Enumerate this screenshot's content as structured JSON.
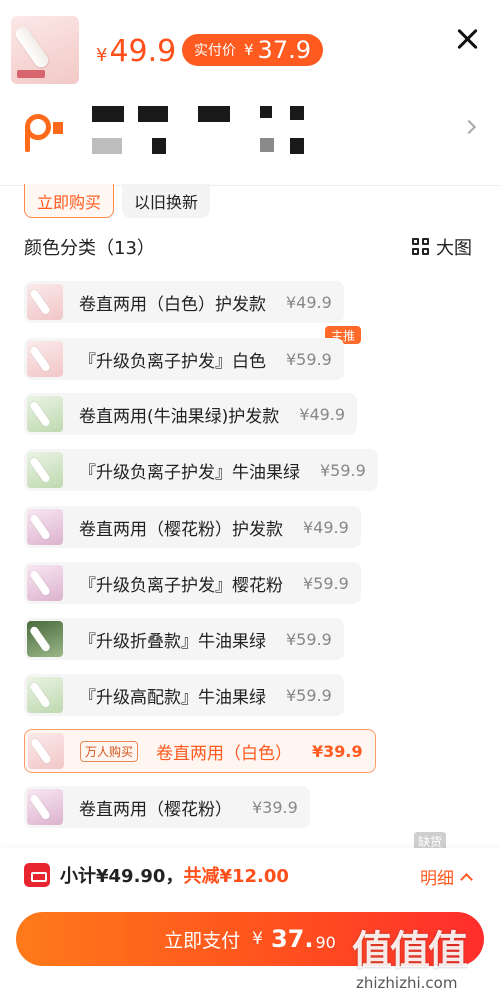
{
  "header": {
    "price_currency": "¥",
    "price": "49.9",
    "pay_label": "实付价",
    "pay_currency": "¥",
    "pay_value": "37.9"
  },
  "tabs": {
    "buy_now": "立即购买",
    "trade_in": "以旧换新"
  },
  "section": {
    "title": "颜色分类（13）",
    "big_image": "大图"
  },
  "options": [
    {
      "name": "卷直两用（白色）护发款",
      "price": "¥49.9",
      "thumb": "pink"
    },
    {
      "name": "『升级负离子护发』白色",
      "price": "¥59.9",
      "thumb": "pink",
      "badge": "主推"
    },
    {
      "name": "卷直两用(牛油果绿)护发款",
      "price": "¥49.9",
      "thumb": "green"
    },
    {
      "name": "『升级负离子护发』牛油果绿",
      "price": "¥59.9",
      "thumb": "green"
    },
    {
      "name": "卷直两用（樱花粉）护发款",
      "price": "¥49.9",
      "thumb": "sakura"
    },
    {
      "name": "『升级负离子护发』樱花粉",
      "price": "¥59.9",
      "thumb": "sakura"
    },
    {
      "name": "『升级折叠款』牛油果绿",
      "price": "¥59.9",
      "thumb": "dark"
    },
    {
      "name": "『升级高配款』牛油果绿",
      "price": "¥59.9",
      "thumb": "green"
    },
    {
      "name": "卷直两用（白色）",
      "price": "¥39.9",
      "thumb": "pink",
      "hot": "万人购买",
      "selected": true
    },
    {
      "name": "卷直两用（樱花粉）",
      "price": "¥39.9",
      "thumb": "sakura"
    }
  ],
  "out_of_stock_badge": "缺货",
  "bottom": {
    "subtotal": "小计¥49.90，",
    "discount": "共减¥12.00",
    "detail": "明细",
    "pay_label": "立即支付",
    "pay_currency": "¥",
    "pay_int": "37.",
    "pay_dec": "90"
  },
  "watermark": {
    "mark": "值值值",
    "url": "zhizhizhi.com"
  },
  "colors": {
    "accent": "#ff5a1f",
    "price": "#ff4f1a",
    "coupon": "#e8262f"
  }
}
